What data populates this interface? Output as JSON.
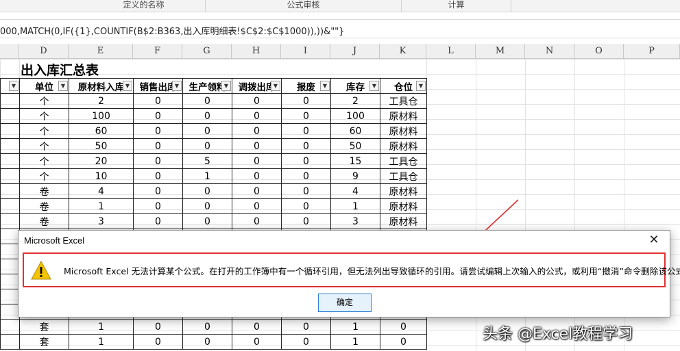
{
  "ribbon": {
    "groups": [
      "定义的名称",
      "公式审核",
      "计算"
    ]
  },
  "formula_bar": {
    "text": "000,MATCH(0,IF({1},COUNTIF(B$2:B363,出入库明细表!$C$2:$C$1000)),))&\"\"}"
  },
  "columns": [
    "D",
    "E",
    "F",
    "G",
    "H",
    "I",
    "J",
    "K",
    "L",
    "M",
    "N",
    "O",
    "P"
  ],
  "sheet": {
    "title": "出入库汇总表",
    "headers": [
      "单位",
      "原材料入库",
      "销售出库",
      "生产领料",
      "调拨出库",
      "报废",
      "库存",
      "仓位"
    ],
    "rows": [
      [
        "个",
        "2",
        "0",
        "0",
        "0",
        "0",
        "2",
        "工具仓"
      ],
      [
        "个",
        "100",
        "0",
        "0",
        "0",
        "0",
        "100",
        "原材料"
      ],
      [
        "个",
        "60",
        "0",
        "0",
        "0",
        "0",
        "60",
        "原材料"
      ],
      [
        "个",
        "50",
        "0",
        "0",
        "0",
        "0",
        "50",
        "原材料"
      ],
      [
        "个",
        "20",
        "0",
        "5",
        "0",
        "0",
        "15",
        "工具仓"
      ],
      [
        "个",
        "10",
        "0",
        "1",
        "0",
        "0",
        "9",
        "工具仓"
      ],
      [
        "卷",
        "4",
        "0",
        "0",
        "0",
        "0",
        "4",
        "原材料"
      ],
      [
        "卷",
        "1",
        "0",
        "0",
        "0",
        "0",
        "1",
        "原材料"
      ],
      [
        "卷",
        "3",
        "0",
        "0",
        "0",
        "0",
        "3",
        "原材料"
      ],
      [
        "",
        "",
        "",
        "",
        "",
        "",
        "",
        ""
      ],
      [
        "",
        "",
        "",
        "",
        "",
        "",
        "",
        ""
      ],
      [
        "",
        "",
        "",
        "",
        "",
        "",
        "",
        ""
      ],
      [
        "",
        "",
        "",
        "",
        "",
        "",
        "",
        ""
      ],
      [
        "",
        "",
        "",
        "",
        "",
        "",
        "",
        ""
      ],
      [
        "",
        "",
        "",
        "",
        "",
        "",
        "",
        ""
      ],
      [
        "套",
        "1",
        "0",
        "0",
        "0",
        "0",
        "1",
        "0"
      ],
      [
        "套",
        "1",
        "0",
        "0",
        "0",
        "0",
        "1",
        "0"
      ]
    ]
  },
  "dialog": {
    "title": "Microsoft Excel",
    "close_glyph": "✕",
    "message": "Microsoft Excel 无法计算某个公式。在打开的工作簿中有一个循环引用，但无法列出导致循环的引用。请尝试编辑上次输入的公式，或利用“撤消”命令删除该公式。",
    "ok_label": "确定",
    "icon": "warning-icon"
  },
  "watermark": "头条 @Excel教程学习",
  "colors": {
    "highlight": "#e03030",
    "button_border": "#2a7fd4",
    "warning_yellow": "#f5c400"
  }
}
